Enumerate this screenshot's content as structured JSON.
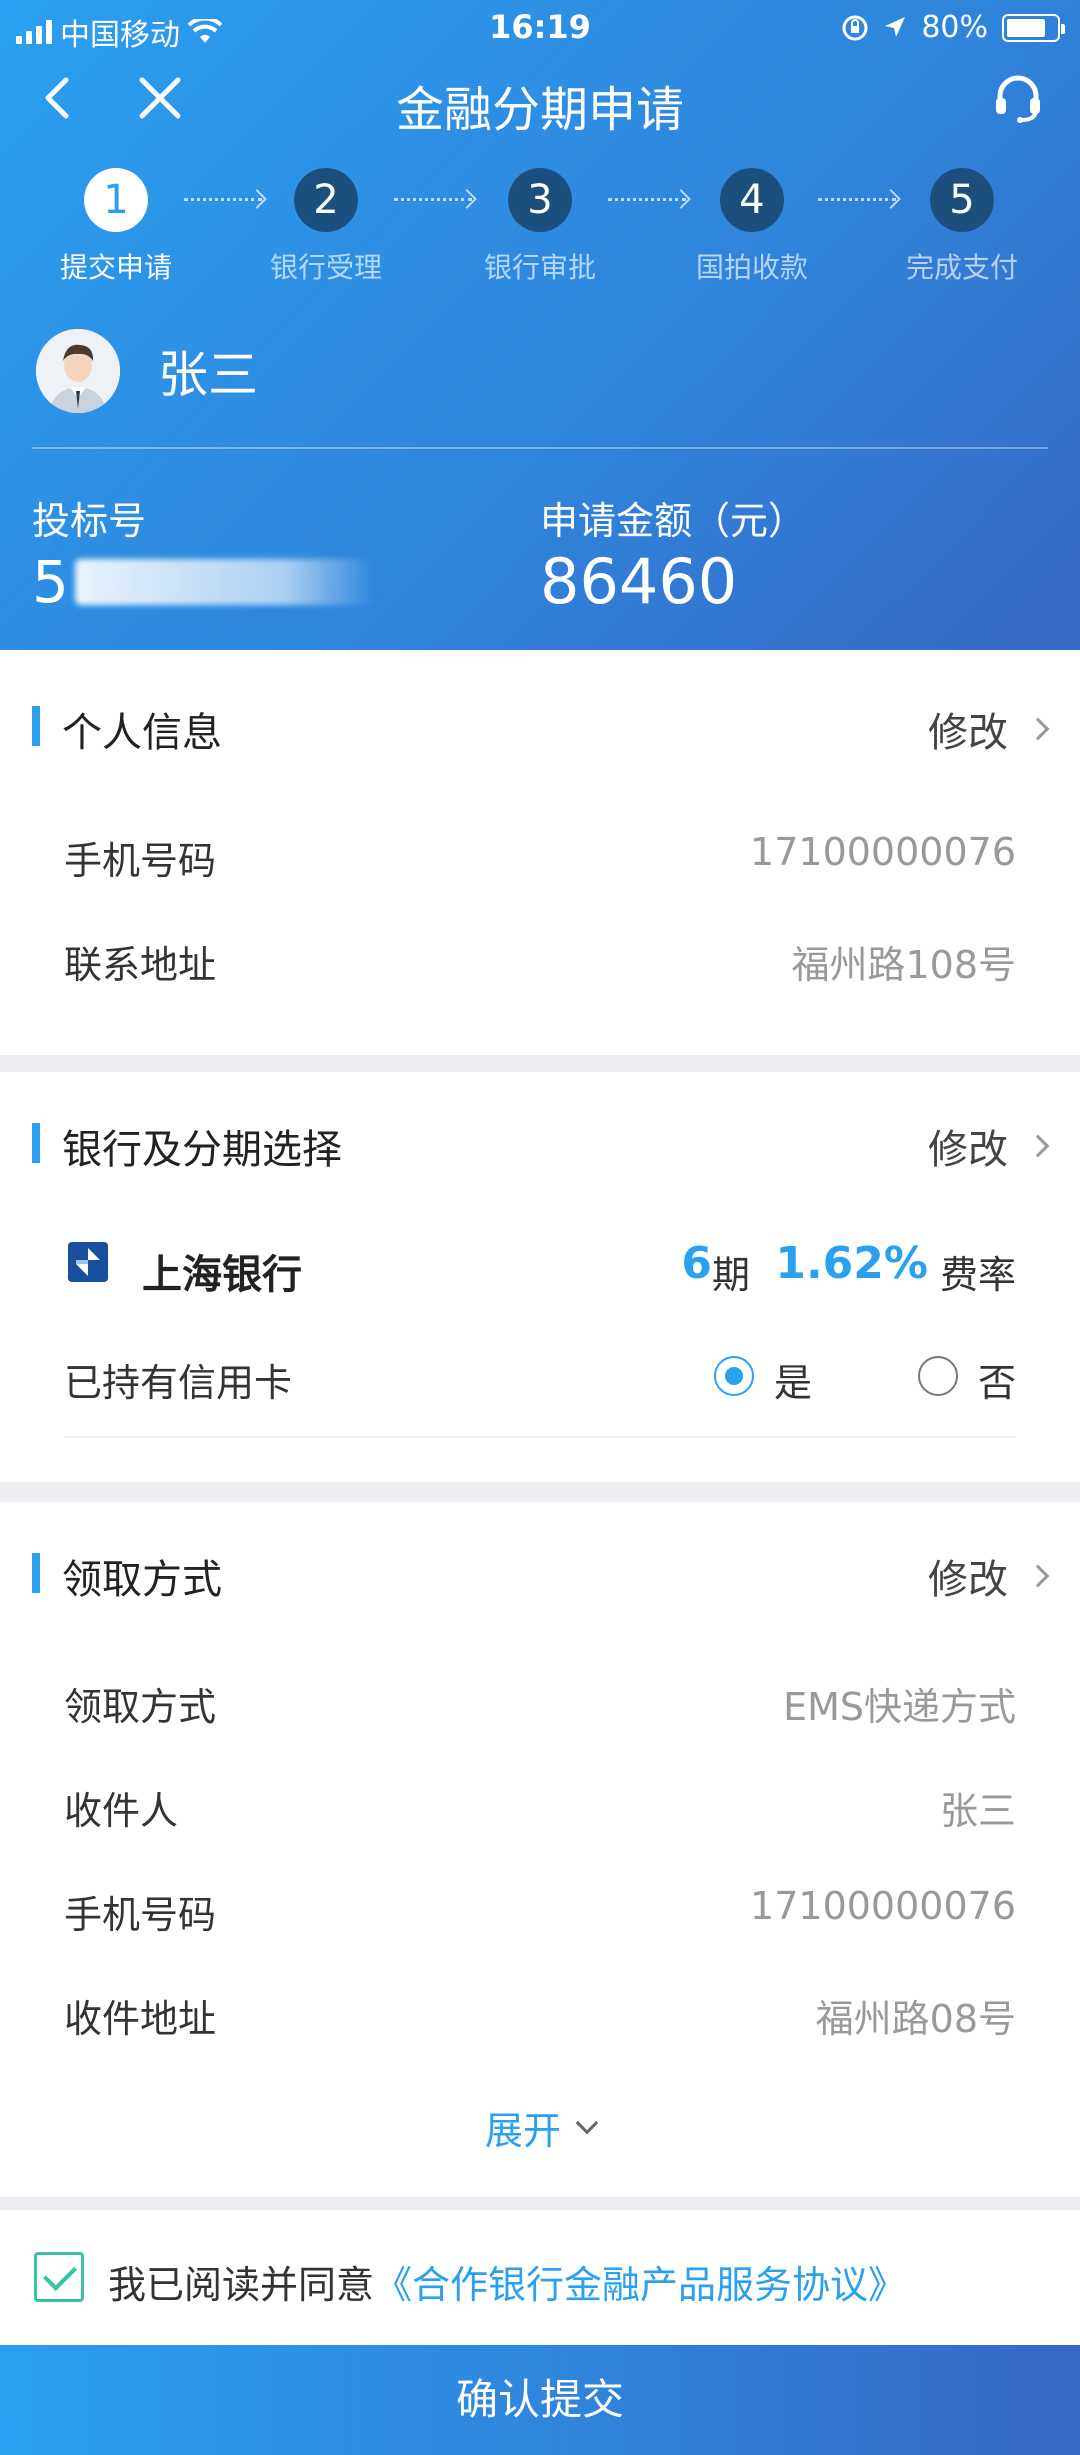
{
  "status": {
    "carrier": "中国移动",
    "time": "16:19",
    "battery": "80%"
  },
  "nav": {
    "title": "金融分期申请"
  },
  "steps": [
    {
      "num": "1",
      "label": "提交申请"
    },
    {
      "num": "2",
      "label": "银行受理"
    },
    {
      "num": "3",
      "label": "银行审批"
    },
    {
      "num": "4",
      "label": "国拍收款"
    },
    {
      "num": "5",
      "label": "完成支付"
    }
  ],
  "user": {
    "name": "张三"
  },
  "summary": {
    "bid_label": "投标号",
    "bid_value": "5",
    "amount_label": "申请金额（元）",
    "amount_value": "86460"
  },
  "personal": {
    "title": "个人信息",
    "edit": "修改",
    "rows": [
      {
        "label": "手机号码",
        "value": "17100000076"
      },
      {
        "label": "联系地址",
        "value": "福州路108号"
      }
    ]
  },
  "bank": {
    "title": "银行及分期选择",
    "edit": "修改",
    "bank_name": "上海银行",
    "period_num": "6",
    "period_unit": "期",
    "rate_num": "1.62%",
    "rate_unit": "费率",
    "credit_label": "已持有信用卡",
    "yes": "是",
    "no": "否"
  },
  "pickup": {
    "title": "领取方式",
    "edit": "修改",
    "rows": [
      {
        "label": "领取方式",
        "value": "EMS快递方式"
      },
      {
        "label": "收件人",
        "value": "张三"
      },
      {
        "label": "手机号码",
        "value": "17100000076"
      },
      {
        "label": "收件地址",
        "value": "福州路08号"
      }
    ],
    "expand": "展开"
  },
  "agreement": {
    "text": "我已阅读并同意",
    "link": "《合作银行金融产品服务协议》"
  },
  "submit": {
    "label": "确认提交"
  }
}
